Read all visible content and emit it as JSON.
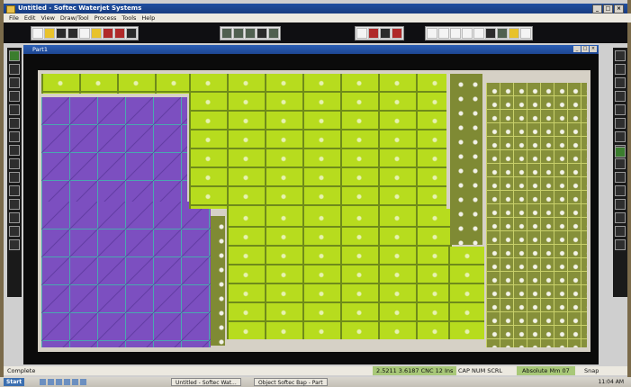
{
  "window": {
    "title": "Untitled - Softec Waterjet Systems"
  },
  "menu": [
    "File",
    "Edit",
    "View",
    "Draw/Tool",
    "Process",
    "Tools",
    "Help"
  ],
  "document": {
    "title": "Part1"
  },
  "status": {
    "left": "Complete",
    "coords": "2.5211 3.6187 CNC 12 Ins",
    "caps": "CAP  NUM  SCRL",
    "mode": "Absolute Mm 07",
    "snap": "Snap"
  },
  "taskbar": {
    "start": "Start",
    "tasks": [
      "Untitled - Softec Wat...",
      "Object Softec Bap - Part"
    ],
    "clock": "11:04 AM"
  }
}
